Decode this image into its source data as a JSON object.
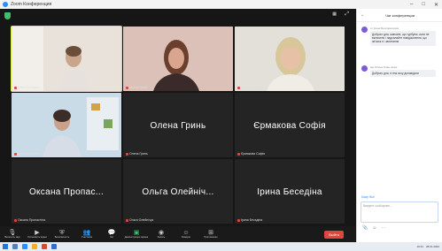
{
  "window": {
    "title": "Zoom Конференция"
  },
  "meeting": {
    "view_label": "Галерея",
    "fullscreen_icon": "fullscreen-icon"
  },
  "participants": [
    {
      "name": "Ірина Бесєдіна",
      "video": true
    },
    {
      "name": "Олена Гринь",
      "video": true
    },
    {
      "name": "Єрмакова Софія",
      "video": true
    },
    {
      "name": "Ірина Бесєдіна",
      "video": true
    },
    {
      "name": "Олена Гринь",
      "display": "Олена Гринь",
      "video": false
    },
    {
      "name": "Єрмакова Софія",
      "display": "Єрмакова Софія",
      "video": false
    },
    {
      "name": "Оксана Пропастіна",
      "display": "Оксана Пропас...",
      "video": false
    },
    {
      "name": "Ольга Олейнічук",
      "display": "Ольга Олейніч...",
      "video": false
    },
    {
      "name": "Ірина Бесєдіна",
      "display": "Ірина Беседіна",
      "video": false
    }
  ],
  "toolbar": [
    {
      "label": "Включить звук",
      "icon": "mic-muted-icon"
    },
    {
      "label": "Остановить видео",
      "icon": "camera-icon"
    },
    {
      "label": "Безопасность",
      "icon": "shield-icon"
    },
    {
      "label": "Участники",
      "icon": "participants-icon"
    },
    {
      "label": "Чат",
      "icon": "chat-icon"
    },
    {
      "label": "Демонстрация экрана",
      "icon": "share-screen-icon"
    },
    {
      "label": "Запись",
      "icon": "record-icon"
    },
    {
      "label": "Реакции",
      "icon": "reactions-icon"
    },
    {
      "label": "Приложения",
      "icon": "apps-icon"
    }
  ],
  "end_button": "Выйти",
  "chat": {
    "header": "Чат конференции",
    "messages": [
      {
        "from": "от Ірина Бесєдіна всем",
        "text": "Доброго дня, шановні, що турбуює, коли не включено і надсилайте повідомлення, що зв'язок є і запитання"
      },
      {
        "from": "від Олена Гринь всем",
        "text": "Доброго дня, я теж хочу доповідати"
      }
    ],
    "to_label": "Кому: Все",
    "input_placeholder": "Введите сообщение..."
  },
  "taskbar": {
    "time": "10:31",
    "date": "28.01.2022"
  },
  "colors": {
    "active_speaker": "#d8e33d",
    "end": "#e0463b",
    "accent": "#2d8cff"
  }
}
